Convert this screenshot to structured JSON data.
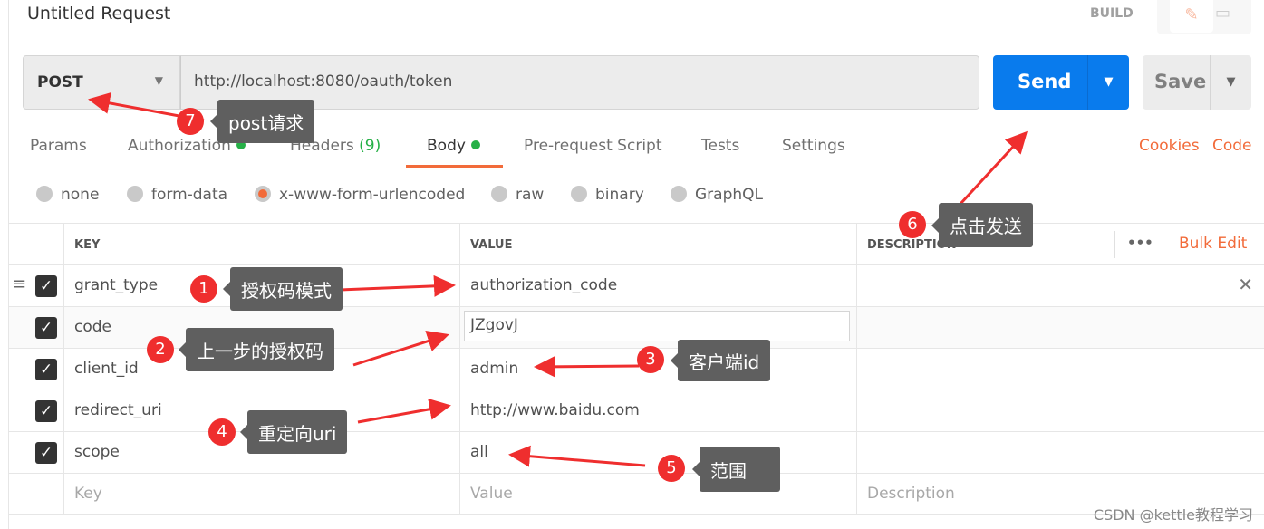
{
  "header": {
    "title": "Untitled Request",
    "mode": "BUILD",
    "icons": [
      "pencil-icon",
      "comment-icon"
    ]
  },
  "request": {
    "method": "POST",
    "url": "http://localhost:8080/oauth/token",
    "send_label": "Send",
    "save_label": "Save"
  },
  "tabs": [
    {
      "label": "Params"
    },
    {
      "label": "Authorization",
      "dot": true
    },
    {
      "label": "Headers",
      "count": "(9)"
    },
    {
      "label": "Body",
      "dot": true,
      "active": true
    },
    {
      "label": "Pre-request Script"
    },
    {
      "label": "Tests"
    },
    {
      "label": "Settings"
    }
  ],
  "links": {
    "cookies": "Cookies",
    "code": "Code"
  },
  "body_types": [
    {
      "label": "none"
    },
    {
      "label": "form-data"
    },
    {
      "label": "x-www-form-urlencoded",
      "selected": true
    },
    {
      "label": "raw"
    },
    {
      "label": "binary"
    },
    {
      "label": "GraphQL"
    }
  ],
  "table": {
    "headers": {
      "key": "KEY",
      "value": "VALUE",
      "description": "DESCRIPTION",
      "bulk_edit": "Bulk Edit",
      "more": "•••"
    },
    "rows": [
      {
        "key": "grant_type",
        "value": "authorization_code",
        "checked": true
      },
      {
        "key": "code",
        "value": "JZgovJ",
        "checked": true
      },
      {
        "key": "client_id",
        "value": "admin",
        "checked": true
      },
      {
        "key": "redirect_uri",
        "value": "http://www.baidu.com",
        "checked": true
      },
      {
        "key": "scope",
        "value": "all",
        "checked": true
      }
    ],
    "placeholder": {
      "key": "Key",
      "value": "Value",
      "description": "Description"
    }
  },
  "annotations": [
    {
      "num": "1",
      "text": "授权码模式"
    },
    {
      "num": "2",
      "text": "上一步的授权码"
    },
    {
      "num": "3",
      "text": "客户端id"
    },
    {
      "num": "4",
      "text": "重定向uri"
    },
    {
      "num": "5",
      "text": "范围"
    },
    {
      "num": "6",
      "text": "点击发送"
    },
    {
      "num": "7",
      "text": "post请求"
    }
  ],
  "accent": "#f26b3a",
  "send_color": "#097bed",
  "annotation_color": "#ef2e2e",
  "watermark": "CSDN @kettle教程学习"
}
